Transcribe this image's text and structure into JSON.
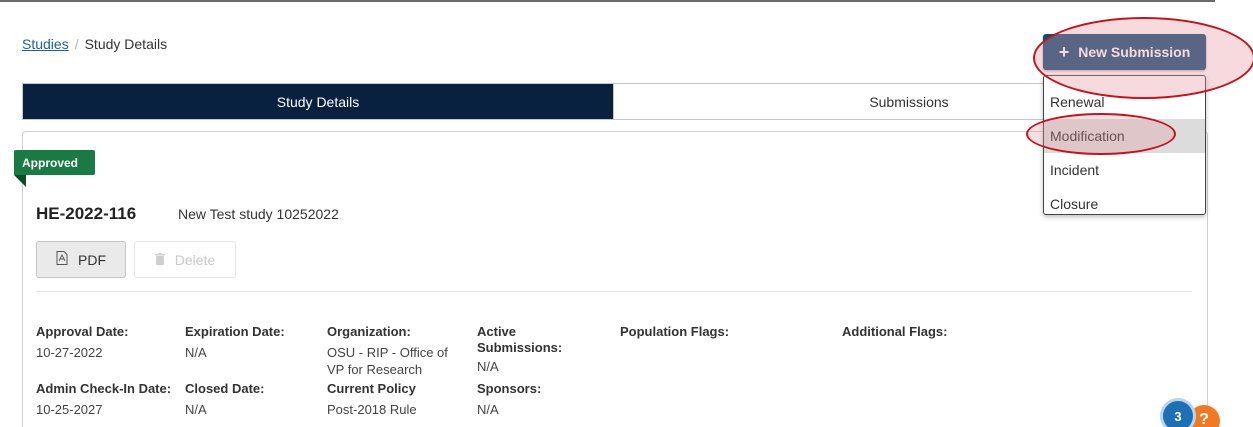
{
  "breadcrumb": {
    "link": "Studies",
    "separator": "/",
    "current": "Study Details"
  },
  "new_submission": {
    "label": "New Submission",
    "menu": [
      "Renewal",
      "Modification",
      "Incident",
      "Closure"
    ],
    "hovered": "Modification"
  },
  "tabs": [
    {
      "label": "Study Details",
      "active": true
    },
    {
      "label": "Submissions",
      "active": false
    }
  ],
  "study": {
    "status": "Approved",
    "id": "HE-2022-116",
    "title": "New Test study 10252022"
  },
  "actions": {
    "pdf": "PDF",
    "delete": "Delete"
  },
  "fields": {
    "approval_date": {
      "label": "Approval Date:",
      "value": "10-27-2022"
    },
    "expiration_date": {
      "label": "Expiration Date:",
      "value": "N/A"
    },
    "organization": {
      "label": "Organization:",
      "value": "OSU - RIP - Office of VP for Research"
    },
    "active_submissions": {
      "label": "Active Submissions:",
      "value": "N/A"
    },
    "population_flags": {
      "label": "Population Flags:",
      "value": ""
    },
    "additional_flags": {
      "label": "Additional Flags:",
      "value": ""
    },
    "admin_checkin_date": {
      "label": "Admin Check-In Date:",
      "value": "10-25-2027"
    },
    "closed_date": {
      "label": "Closed Date:",
      "value": "N/A"
    },
    "current_policy": {
      "label": "Current Policy",
      "value": "Post-2018 Rule"
    },
    "sponsors": {
      "label": "Sponsors:",
      "value": "N/A"
    }
  },
  "help": {
    "badge_count": "3",
    "widget_text": "?"
  },
  "colors": {
    "active_tab": "#08213f",
    "primary_button": "#0f4c75",
    "status_approved": "#1a7a43",
    "link": "#1f5fa6",
    "annotation": "#c0141e"
  }
}
